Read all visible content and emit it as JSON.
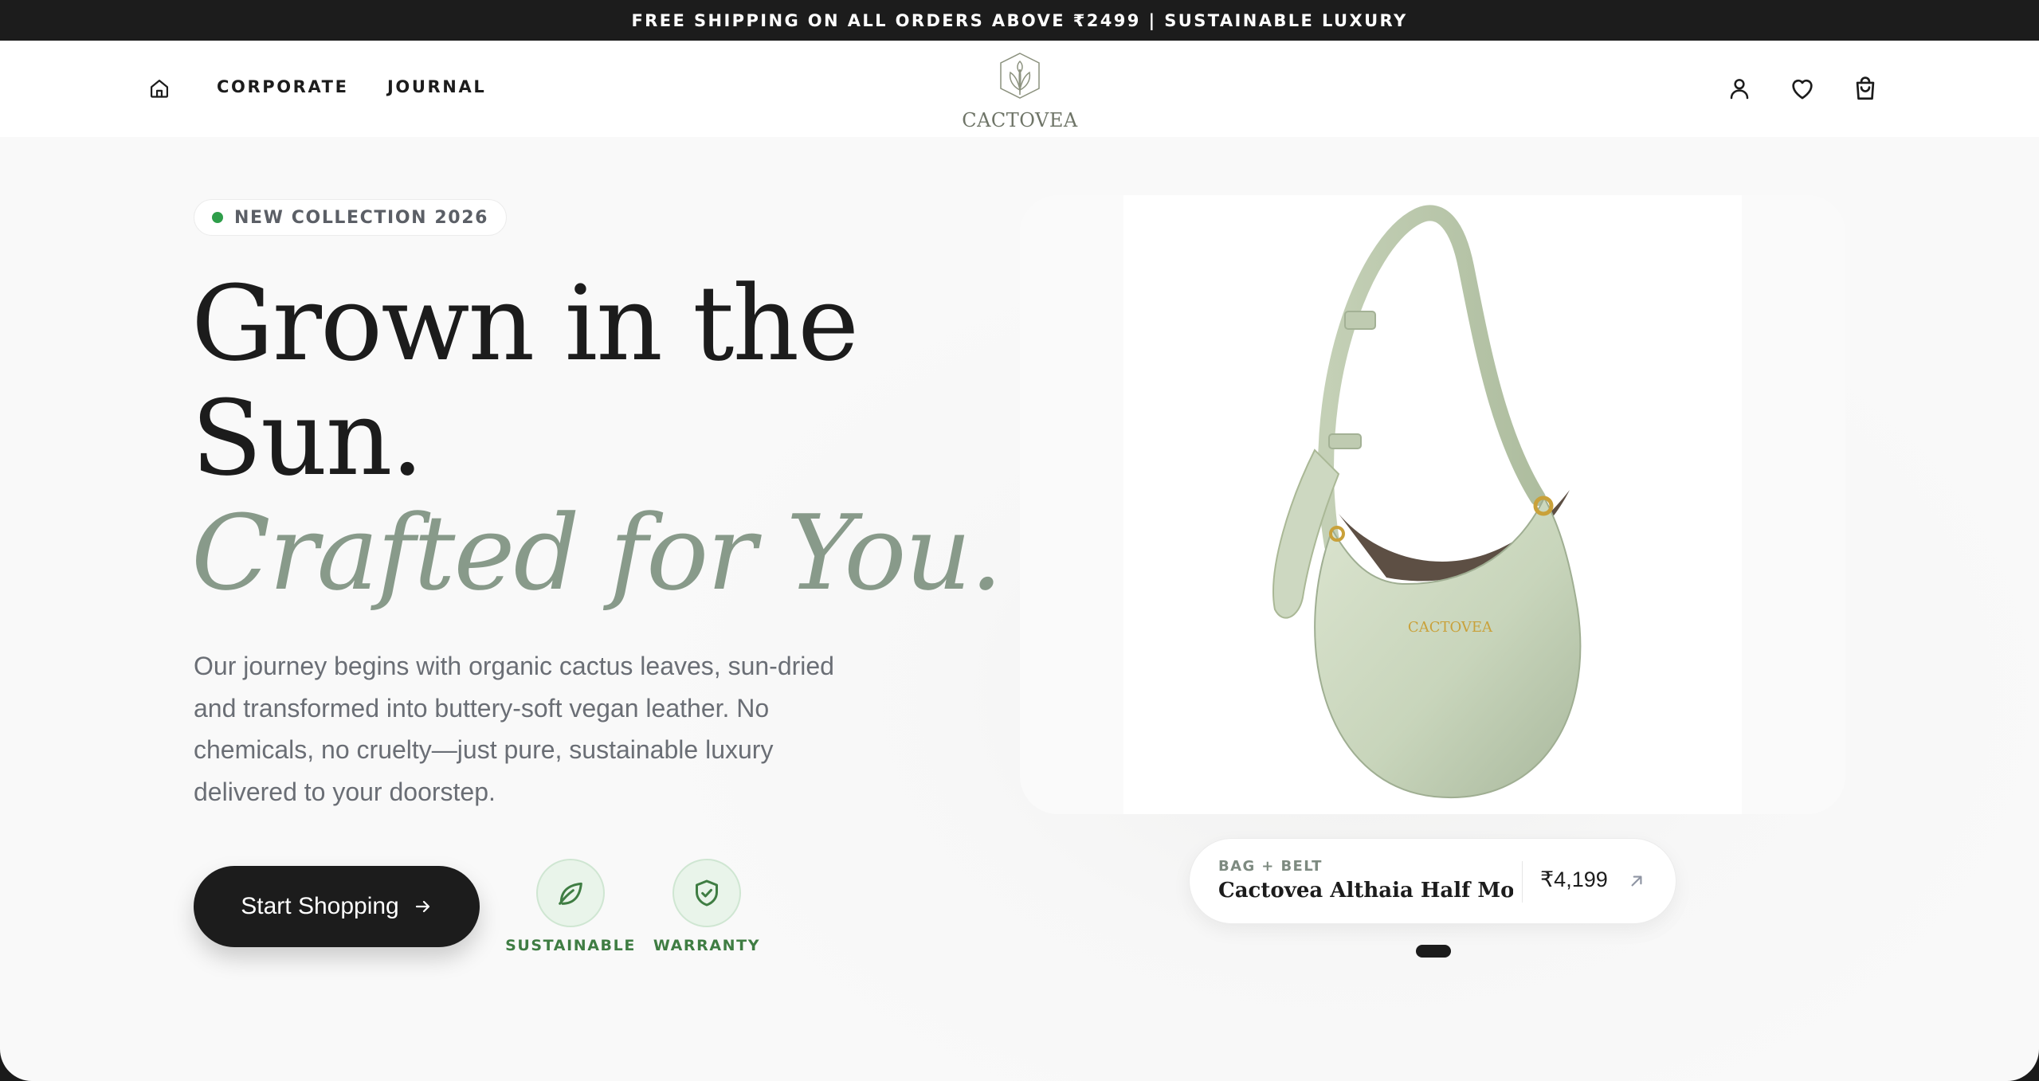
{
  "announcement": {
    "text": "FREE SHIPPING ON ALL ORDERS ABOVE ₹2499 | SUSTAINABLE LUXURY"
  },
  "header": {
    "nav": {
      "corporate": "CORPORATE",
      "journal": "JOURNAL"
    },
    "logo": {
      "text": "CACTOVEA"
    },
    "icons": [
      "home-icon",
      "user-icon",
      "heart-icon",
      "bag-icon"
    ]
  },
  "hero": {
    "badge": "NEW COLLECTION 2026",
    "headline": {
      "line1": "Grown in the",
      "line2": "Sun.",
      "line3": "Crafted for You."
    },
    "description": "Our journey begins with organic cactus leaves, sun-dried and transformed into buttery-soft vegan leather. No chemicals, no cruelty—just pure, sustainable luxury delivered to your doorstep.",
    "cta": "Start Shopping",
    "features": [
      {
        "label": "SUSTAINABLE",
        "icon": "leaf-icon"
      },
      {
        "label": "WARRANTY",
        "icon": "shield-check-icon"
      }
    ],
    "product": {
      "category": "BAG + BELT",
      "name": "Cactovea Althaia Half Mo...",
      "price": "₹4,199",
      "bag_brand": "CACTOVEA"
    }
  },
  "colors": {
    "dark": "#1c1c1c",
    "sage": "#889a8a",
    "bag": "#c9d6bd",
    "green": "#3f7d43",
    "gold": "#c9a13a"
  }
}
